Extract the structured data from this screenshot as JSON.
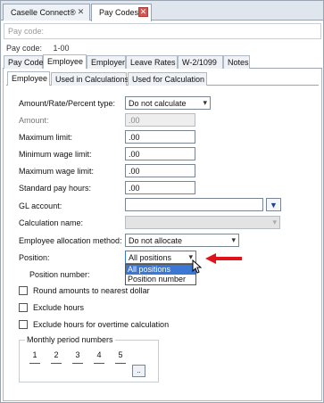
{
  "doc_tabs": [
    {
      "label": "Caselle Connect®",
      "active": false
    },
    {
      "label": "Pay Codes",
      "active": true
    }
  ],
  "filter": {
    "placeholder": "Pay code:"
  },
  "paycode": {
    "label": "Pay code:",
    "value": "1-00"
  },
  "main_tabs": [
    "Pay Code",
    "Employee",
    "Employer",
    "Leave Rates",
    "W-2/1099",
    "Notes"
  ],
  "sub_tabs": [
    "Employee",
    "Used in Calculations",
    "Used for Calculation"
  ],
  "form": {
    "amount_type": {
      "label": "Amount/Rate/Percent type:",
      "value": "Do not calculate"
    },
    "amount": {
      "label": "Amount:",
      "value": ".00"
    },
    "max_limit": {
      "label": "Maximum limit:",
      "value": ".00"
    },
    "min_wage_limit": {
      "label": "Minimum wage limit:",
      "value": ".00"
    },
    "max_wage_limit": {
      "label": "Maximum wage limit:",
      "value": ".00"
    },
    "std_pay_hours": {
      "label": "Standard pay hours:",
      "value": ".00"
    },
    "gl_account": {
      "label": "GL account:",
      "value": ""
    },
    "calc_name": {
      "label": "Calculation name:",
      "value": ""
    },
    "alloc_method": {
      "label": "Employee allocation method:",
      "value": "Do not allocate"
    },
    "position": {
      "label": "Position:",
      "value": "All positions",
      "options": [
        "All positions",
        "Position number"
      ]
    },
    "position_number": {
      "label": "Position number:"
    }
  },
  "checkboxes": [
    {
      "label": "Round amounts to nearest dollar",
      "checked": false
    },
    {
      "label": "Exclude hours",
      "checked": false
    },
    {
      "label": "Exclude hours for overtime calculation",
      "checked": false
    }
  ],
  "monthly": {
    "legend": "Monthly period numbers",
    "months": [
      "1",
      "2",
      "3",
      "4",
      "5"
    ],
    "button": ".."
  },
  "colors": {
    "accent": "#3b78d4",
    "arrow": "#e0131b",
    "close": "#d9534f"
  },
  "icons": {
    "close": "x",
    "dropdown": "▾",
    "lookup": "▼",
    "pointer": "arrow-cursor"
  }
}
